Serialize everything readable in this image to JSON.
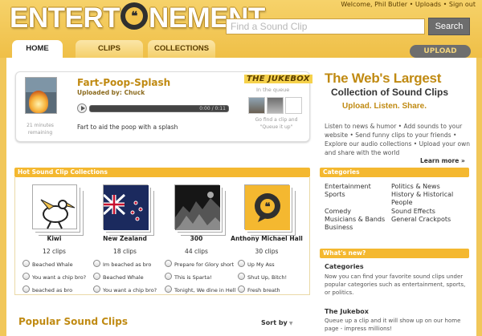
{
  "header": {
    "logo_text_start": "ENTERT",
    "logo_text_end": "NEMENT",
    "logo_quote": "❝",
    "user_links": "Welcome, Phil Butler • Uploads • Sign out",
    "search": {
      "placeholder": "Find a Sound Clip",
      "button": "Search"
    },
    "tabs": [
      "HOME",
      "CLIPS",
      "COLLECTIONS"
    ],
    "upload": "UPLOAD"
  },
  "player": {
    "time_ago": "21 minutes remaining",
    "title": "Fart-Poop-Splash",
    "uploaded_by_label": "Uploaded by:",
    "uploader": "Chuck",
    "time": "0:00 / 0:11",
    "description": "Fart to aid the poop with a splash",
    "progress_fraction": 0.0
  },
  "jukebox": {
    "title": "THE JUKEBOX",
    "queue_label": "In the queue",
    "hint": "Go find a clip and \"Queue it up\""
  },
  "promo": {
    "headline": "The Web's Largest",
    "subheadline": "Collection of Sound Clips",
    "tagline": "Upload. Listen. Share.",
    "text": "Listen to news & humor • Add sounds to your website • Send funny clips to your friends • Explore our audio collections • Upload your own and share with the world",
    "learn_more": "Learn more »"
  },
  "hot_collections": {
    "title": "Hot Sound Clip Collections",
    "items": [
      {
        "name": "Kiwi",
        "count": "12 clips",
        "clips": [
          "Beached Whale",
          "You want a chip bro?",
          "beached as bro"
        ]
      },
      {
        "name": "New Zealand",
        "count": "18 clips",
        "clips": [
          "Im beached as bro",
          "Beached Whale",
          "You want a chip bro?"
        ]
      },
      {
        "name": "300",
        "count": "44 clips",
        "clips": [
          "Prepare for Glory short",
          "This is Sparta!",
          "Tonight, We dine in Hell"
        ]
      },
      {
        "name": "Anthony Michael Hall",
        "count": "30 clips",
        "clips": [
          "Up My Ass",
          "Shut Up, Bitch!",
          "Fresh breath"
        ]
      }
    ]
  },
  "categories": {
    "title": "Categories",
    "col1": [
      "Entertainment",
      "Sports",
      "",
      "Comedy",
      "Musicians & Bands",
      "Business"
    ],
    "col2": [
      "Politics & News",
      "History & Historical",
      "People",
      "Sound Effects",
      "General Crackpots"
    ]
  },
  "whats_new": {
    "title": "What's new?",
    "h1": "Categories",
    "t1": "Now you can find your favorite sound clips under popular categories such as entertainment, sports, or politics.",
    "h2": "The Jukebox",
    "t2": "Queue up a clip and it will show up on our home page - impress millions!"
  },
  "popular": {
    "title": "Popular Sound Clips",
    "sort": "Sort by"
  },
  "colors": {
    "accent": "#c08a12",
    "bar": "#f4b830",
    "background": "#f1c75a"
  }
}
